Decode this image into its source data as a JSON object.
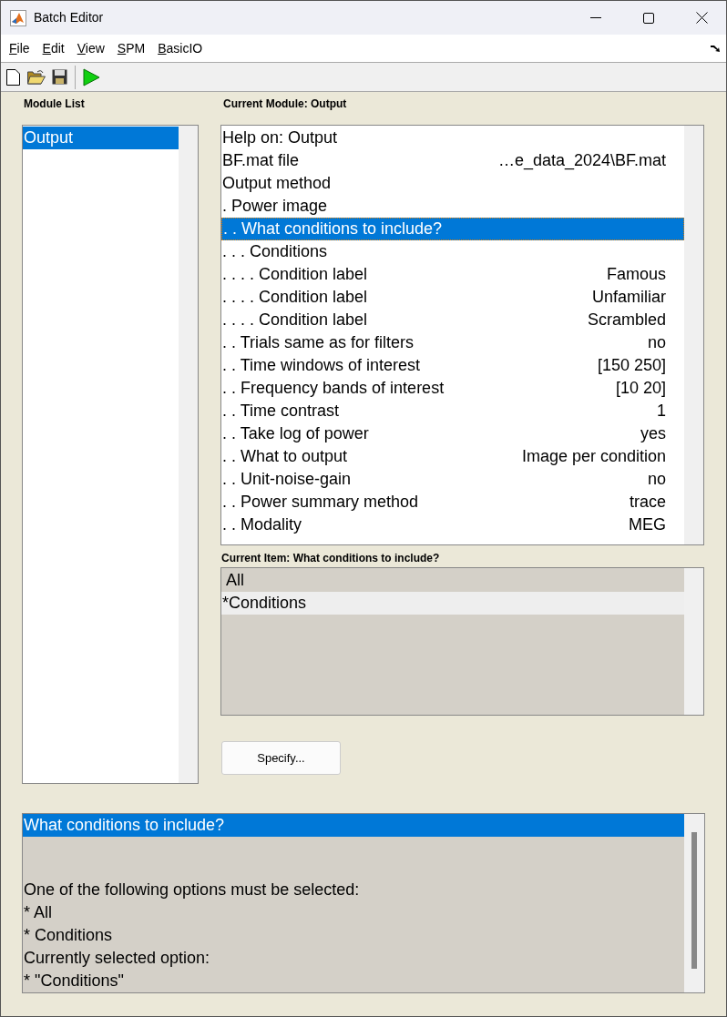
{
  "window": {
    "title": "Batch Editor"
  },
  "menu": [
    {
      "label": "File"
    },
    {
      "label": "Edit"
    },
    {
      "label": "View"
    },
    {
      "label": "SPM"
    },
    {
      "label": "BasicIO"
    }
  ],
  "module_list": {
    "title": "Module List",
    "items": [
      {
        "label": "Output",
        "selected": true
      }
    ]
  },
  "current_module": {
    "title": "Current Module: Output",
    "rows": [
      {
        "label": "Help on: Output",
        "value": "",
        "selected": false
      },
      {
        "label": "BF.mat file",
        "value": "…e_data_2024\\BF.mat",
        "selected": false
      },
      {
        "label": "Output method",
        "value": "",
        "selected": false
      },
      {
        "label": ". Power image",
        "value": "",
        "selected": false
      },
      {
        "label": ". . What conditions to include?",
        "value": "",
        "selected": true
      },
      {
        "label": ". . . Conditions",
        "value": "",
        "selected": false
      },
      {
        "label": ". . . . Condition label",
        "value": "Famous",
        "selected": false
      },
      {
        "label": ". . . . Condition label",
        "value": "Unfamiliar",
        "selected": false
      },
      {
        "label": ". . . . Condition label",
        "value": "Scrambled",
        "selected": false
      },
      {
        "label": ". . Trials same as for filters",
        "value": "no",
        "selected": false
      },
      {
        "label": ". . Time windows of interest",
        "value": "[150 250]",
        "selected": false
      },
      {
        "label": ". . Frequency bands of interest",
        "value": "[10 20]",
        "selected": false
      },
      {
        "label": ". . Time contrast",
        "value": "1",
        "selected": false
      },
      {
        "label": ". . Take log of power",
        "value": "yes",
        "selected": false
      },
      {
        "label": ". . What to output",
        "value": "Image per condition",
        "selected": false
      },
      {
        "label": ". . Unit-noise-gain",
        "value": "no",
        "selected": false
      },
      {
        "label": ". . Power summary method",
        "value": "trace",
        "selected": false
      },
      {
        "label": ". . Modality",
        "value": "MEG",
        "selected": false
      }
    ]
  },
  "current_item": {
    "title": "Current Item: What conditions to include?",
    "options": [
      {
        "label": " All",
        "selected": false
      },
      {
        "label": "*Conditions",
        "selected": true
      }
    ]
  },
  "specify_button": "Specify...",
  "help": {
    "heading": "What conditions to include?",
    "lines": [
      "One of the following options must be selected:",
      "* All",
      "* Conditions",
      "Currently selected option:",
      "* \"Conditions\""
    ]
  }
}
